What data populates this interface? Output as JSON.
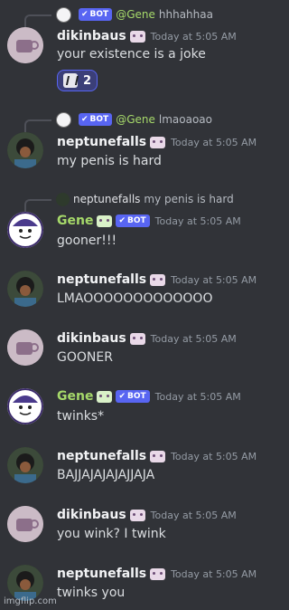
{
  "messages": [
    {
      "reply": {
        "mention": "@Gene",
        "text": "hhhahhaa",
        "bot_label": "BOT"
      },
      "username": "dikinbaus",
      "time": "Today at 5:05 AM",
      "text": "your existence is a joke",
      "reaction": {
        "count": "2"
      }
    },
    {
      "reply": {
        "mention": "@Gene",
        "text": "lmaoaoao",
        "bot_label": "BOT"
      },
      "username": "neptunefalls",
      "time": "Today at 5:05 AM",
      "text": "my penis is hard"
    },
    {
      "reply": {
        "name": "neptunefalls",
        "text": "my penis is hard"
      },
      "username": "Gene",
      "bot_label": "BOT",
      "time": "Today at 5:05 AM",
      "text": "gooner!!!"
    },
    {
      "username": "neptunefalls",
      "time": "Today at 5:05 AM",
      "text": "LMAOOOOOOOOOOOOO"
    },
    {
      "username": "dikinbaus",
      "time": "Today at 5:05 AM",
      "text": "GOONER"
    },
    {
      "username": "Gene",
      "bot_label": "BOT",
      "time": "Today at 5:05 AM",
      "text": "twinks*"
    },
    {
      "username": "neptunefalls",
      "time": "Today at 5:05 AM",
      "text": "BAJJAJAJAJAJJAJA"
    },
    {
      "username": "dikinbaus",
      "time": "Today at 5:05 AM",
      "text": "you wink? I twink"
    },
    {
      "username": "neptunefalls",
      "time": "Today at 5:05 AM",
      "text": "twinks you"
    }
  ],
  "watermark": "imgflip.com",
  "colors": {
    "background": "#313338",
    "bot_badge": "#5865f2",
    "gene_name": "#a6d96a",
    "timestamp": "#949ba4"
  }
}
